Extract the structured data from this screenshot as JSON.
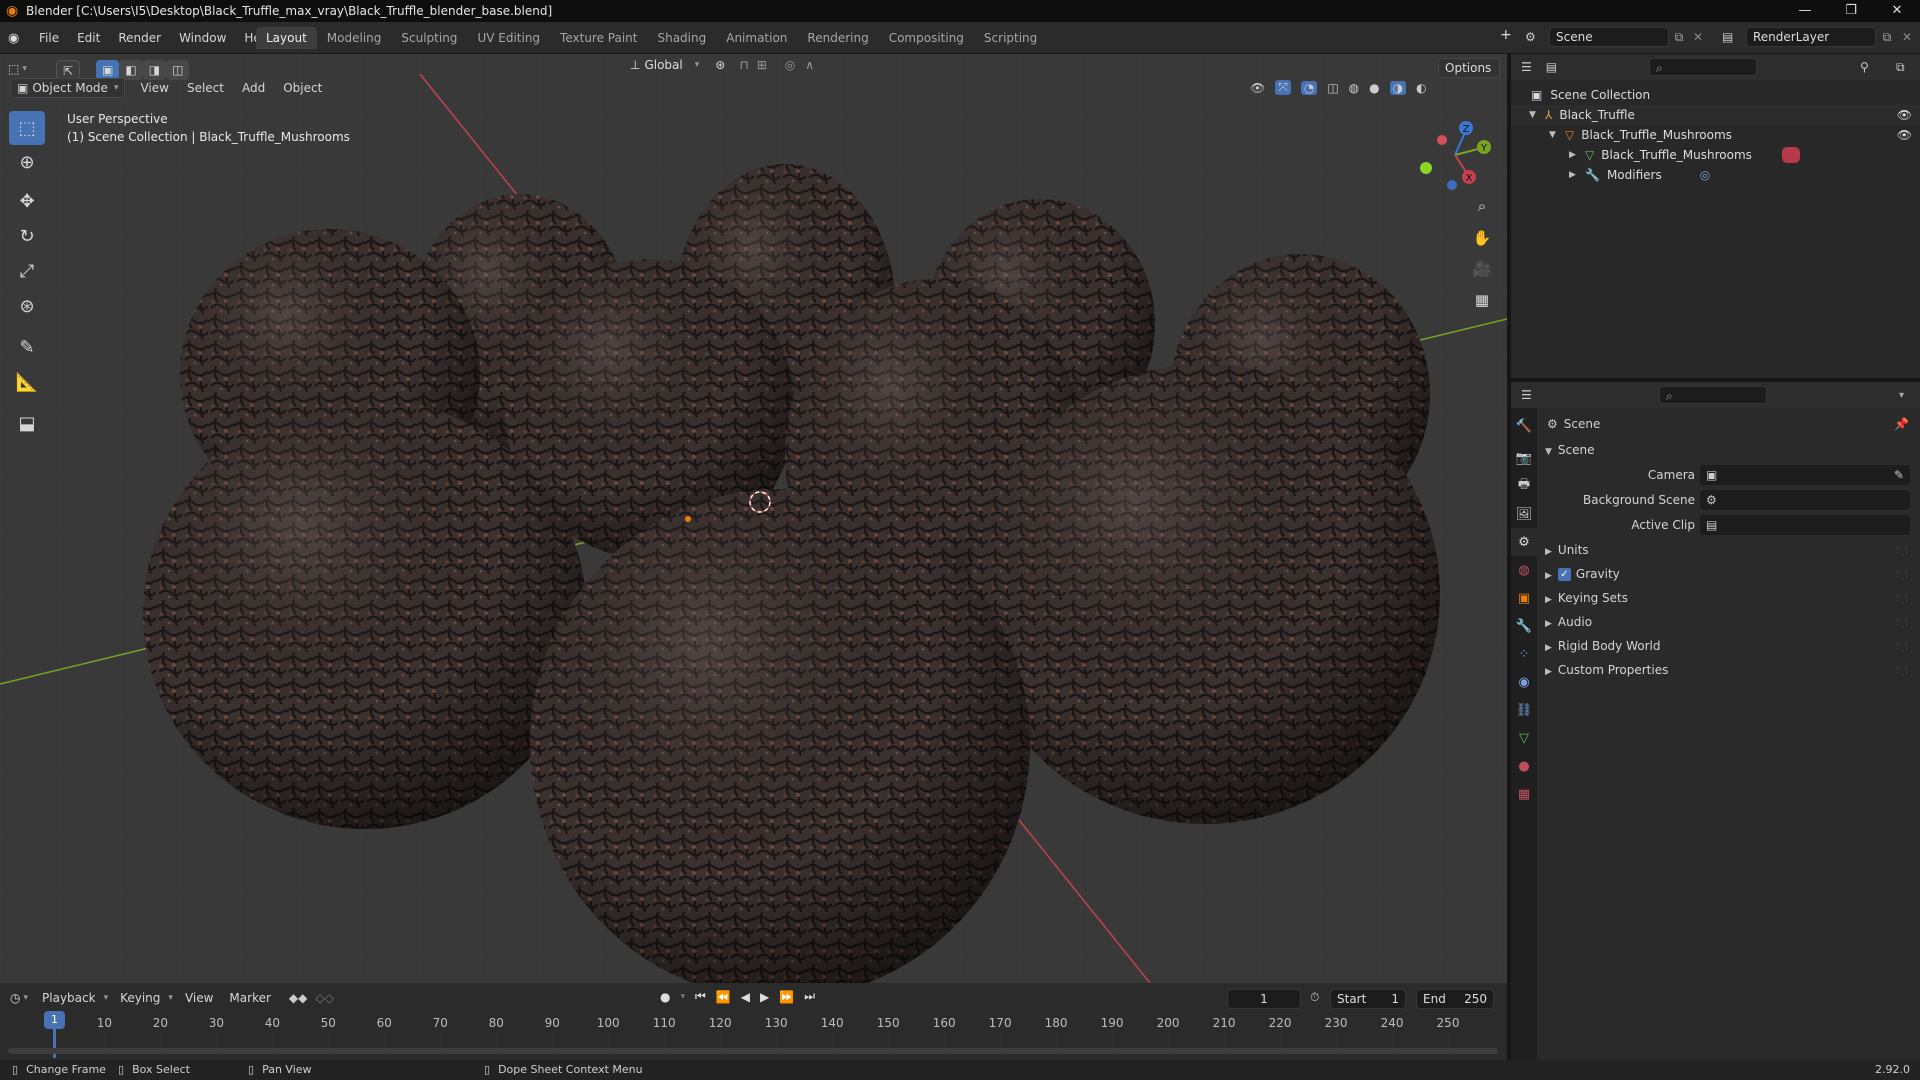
{
  "window": {
    "title": "Blender [C:\\Users\\I5\\Desktop\\Black_Truffle_max_vray\\Black_Truffle_blender_base.blend]"
  },
  "menu": [
    "File",
    "Edit",
    "Render",
    "Window",
    "Help"
  ],
  "workspaces": [
    "Layout",
    "Modeling",
    "Sculpting",
    "UV Editing",
    "Texture Paint",
    "Shading",
    "Animation",
    "Rendering",
    "Compositing",
    "Scripting"
  ],
  "topbar": {
    "scene": "Scene",
    "view_layer": "RenderLayer",
    "transform_orientation": "Global",
    "options": "Options"
  },
  "viewport": {
    "mode": "Object Mode",
    "header_menus": [
      "View",
      "Select",
      "Add",
      "Object"
    ],
    "overlay_line1": "User Perspective",
    "overlay_line2": "(1) Scene Collection | Black_Truffle_Mushrooms",
    "gizmo": {
      "x": "X",
      "y": "Y",
      "z": "Z"
    }
  },
  "outliner": {
    "root": "Scene Collection",
    "items": [
      {
        "label": "Black_Truffle",
        "level": 1
      },
      {
        "label": "Black_Truffle_Mushrooms",
        "level": 2
      },
      {
        "label": "Black_Truffle_Mushrooms",
        "level": 3
      },
      {
        "label": "Modifiers",
        "level": 3
      }
    ]
  },
  "properties": {
    "breadcrumb": "Scene",
    "panel": "Scene",
    "fields": [
      {
        "label": "Camera"
      },
      {
        "label": "Background Scene"
      },
      {
        "label": "Active Clip"
      }
    ],
    "subpanels": [
      "Units",
      "Gravity",
      "Keying Sets",
      "Audio",
      "Rigid Body World",
      "Custom Properties"
    ],
    "gravity_checked": true
  },
  "timeline": {
    "menus": [
      "Playback",
      "Keying",
      "View",
      "Marker"
    ],
    "current_frame": "1",
    "start_label": "Start",
    "start": "1",
    "end_label": "End",
    "end": "250",
    "ticks": [
      "1",
      "10",
      "20",
      "30",
      "40",
      "50",
      "60",
      "70",
      "80",
      "90",
      "100",
      "110",
      "120",
      "130",
      "140",
      "150",
      "160",
      "170",
      "180",
      "190",
      "200",
      "210",
      "220",
      "230",
      "240",
      "250"
    ]
  },
  "statusbar": {
    "items": [
      "Change Frame",
      "Box Select",
      "Pan View",
      "Dope Sheet Context Menu"
    ],
    "version": "2.92.0"
  },
  "colors": {
    "accent": "#4772b3",
    "axis_x": "#c4414f",
    "axis_y": "#7aa322",
    "axis_z": "#3b78d6",
    "truffle": "#3a3130",
    "active_orange": "#e87d0d"
  }
}
